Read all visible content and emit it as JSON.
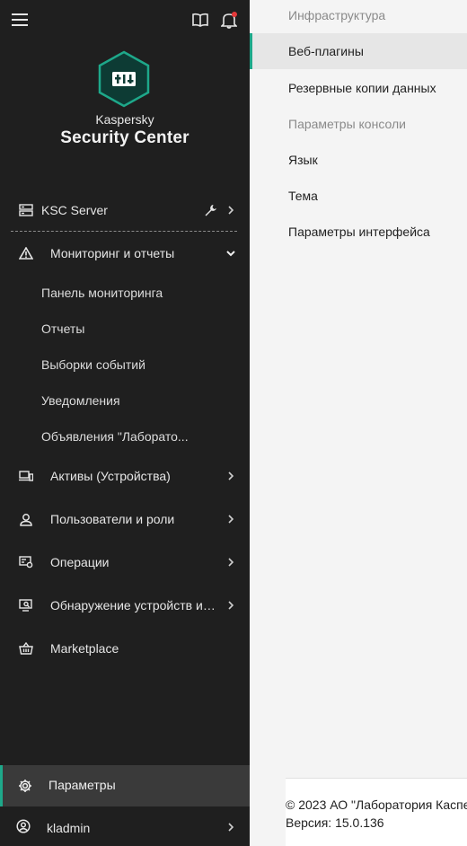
{
  "brand": {
    "small": "Kaspersky",
    "big": "Security Center"
  },
  "colors": {
    "sidebar_bg": "#1f1f1f",
    "accent": "#1ea88a",
    "notification_dot": "#e5393a"
  },
  "topbar": {
    "icons": [
      "menu-icon",
      "book-icon",
      "bell-icon"
    ]
  },
  "sidebar": {
    "server": {
      "label": "KSC Server",
      "icons": [
        "server-icon",
        "wrench-icon",
        "chevron-right-icon"
      ]
    },
    "monitoring": {
      "label": "Мониторинг и отчеты",
      "children": [
        "Панель мониторинга",
        "Отчеты",
        "Выборки событий",
        "Уведомления",
        "Объявления \"Лаборато..."
      ]
    },
    "items": [
      {
        "label": "Активы (Устройства)",
        "icon": "devices-icon"
      },
      {
        "label": "Пользователи и роли",
        "icon": "user-icon"
      },
      {
        "label": "Операции",
        "icon": "operations-icon"
      },
      {
        "label": "Обнаружение устройств и ...",
        "icon": "discovery-icon"
      },
      {
        "label": "Marketplace",
        "icon": "basket-icon"
      }
    ],
    "settings": {
      "label": "Параметры"
    },
    "user": {
      "label": "kladmin"
    }
  },
  "settings_menu": {
    "items": [
      {
        "label": "Инфраструктура",
        "state": "muted"
      },
      {
        "label": "Веб-плагины",
        "state": "active"
      },
      {
        "label": "Резервные копии данных",
        "state": "normal"
      },
      {
        "label": "Параметры консоли",
        "state": "muted"
      },
      {
        "label": "Язык",
        "state": "normal"
      },
      {
        "label": "Тема",
        "state": "normal"
      },
      {
        "label": "Параметры интерфейса",
        "state": "normal"
      }
    ]
  },
  "footer": {
    "copyright": "© 2023 АО \"Лаборатория Каспе",
    "version": "Версия: 15.0.136"
  }
}
